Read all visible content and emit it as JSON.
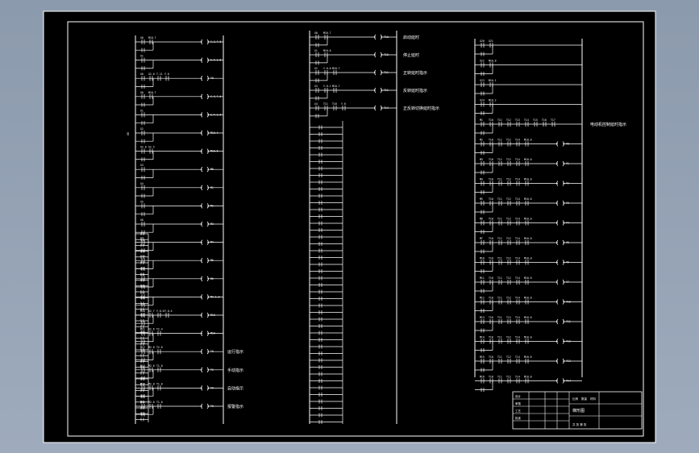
{
  "colors": {
    "background": "#9eabbd",
    "sheet": "#000000",
    "ink": "#ffffff"
  },
  "diagram_kind": "plc-ladder-diagram",
  "rail_labels": {
    "left_power_rail": "X0"
  },
  "left_column": {
    "rungs": [
      {
        "contacts": [
          "X0",
          "M10.7"
        ],
        "coil": "C.S.F.5",
        "comment": ""
      },
      {
        "contacts": [
          "X1"
        ],
        "coil": "S.F.1.5",
        "comment": ""
      },
      {
        "contacts": [
          "X0",
          "X2.0",
          "T.11",
          "Y.0"
        ],
        "coil": "Y0",
        "comment": ""
      },
      {
        "contacts": [
          "X0",
          "M10.7"
        ],
        "coil": "C.S.F.6",
        "comment": ""
      },
      {
        "contacts": [
          "X1"
        ],
        "coil": "S.F.1.6",
        "comment": ""
      },
      {
        "contacts": [
          "X2"
        ],
        "coil": "M10.4",
        "comment": ""
      },
      {
        "contacts": [
          "X2.0",
          "X2.5"
        ],
        "coil": "M10.5",
        "comment": ""
      },
      {
        "contacts": [
          "X3"
        ],
        "coil": "M0",
        "comment": ""
      },
      {
        "contacts": [
          "X4"
        ],
        "coil": "M1",
        "comment": ""
      },
      {
        "contacts": [
          "X5"
        ],
        "coil": "M2",
        "comment": ""
      },
      {
        "contacts": [
          "X6"
        ],
        "coil": "M3",
        "comment": ""
      },
      {
        "contacts": [
          "X7"
        ],
        "coil": "M4",
        "comment": ""
      },
      {
        "contacts": [
          "X10"
        ],
        "coil": "M5",
        "comment": ""
      },
      {
        "contacts": [
          "X11"
        ],
        "coil": "M6",
        "comment": ""
      },
      {
        "contacts": [
          "X12"
        ],
        "coil": "M2.1.0",
        "comment": ""
      },
      {
        "contacts": [
          "M10",
          "X2.7",
          "Y.0.0",
          "Y.0.4"
        ],
        "coil": "M10",
        "comment": ""
      },
      {
        "contacts": [
          "M11",
          "X2.6",
          "T2.4"
        ],
        "coil": "M10",
        "comment": ""
      },
      {
        "contacts": [
          "M12",
          "M2.0",
          "T2.0"
        ],
        "coil": "T0",
        "comment": "运行指示"
      },
      {
        "contacts": [
          "M13",
          "M2.0",
          "T1.0"
        ],
        "coil": "T0",
        "comment": "手动指示"
      },
      {
        "contacts": [
          "M14",
          "M2.0",
          "T1.0"
        ],
        "coil": "T0",
        "comment": "自动指示"
      },
      {
        "contacts": [
          "M15",
          "M2.0",
          "T1.0"
        ],
        "coil": "T0",
        "comment": "报警指示"
      }
    ]
  },
  "middle_column": {
    "rungs": [
      {
        "contacts": [
          "X0",
          "M10.7"
        ],
        "coil": "T10",
        "comment": "启动延时"
      },
      {
        "contacts": [
          "X1",
          "M10.6"
        ],
        "coil": "T10",
        "comment": "停止延时"
      },
      {
        "contacts": [
          "X2",
          "Y.0.0",
          "M10.7"
        ],
        "coil": "T11",
        "comment": "正转延时指示"
      },
      {
        "contacts": [
          "X3",
          "Y.0.1",
          "M10.7"
        ],
        "coil": "T11",
        "comment": "反转延时指示"
      },
      {
        "contacts": [
          "X4",
          "T11",
          "T10",
          "Y.0"
        ],
        "coil": "T14",
        "comment": "正反转切换延时指示"
      }
    ]
  },
  "right_column": {
    "rungs": [
      {
        "contacts": [
          "X20",
          "X21"
        ],
        "coil": "",
        "comment": ""
      },
      {
        "contacts": [
          "X22",
          "M10.0"
        ],
        "coil": "",
        "comment": ""
      },
      {
        "contacts": [
          "X23",
          "M10.1"
        ],
        "coil": "",
        "comment": ""
      },
      {
        "contacts": [
          "X24",
          "M10.2"
        ],
        "coil": "",
        "comment": ""
      },
      {
        "contacts": [
          "M1",
          "T10",
          "T11",
          "T12",
          "T13",
          "T14",
          "T15",
          "T16",
          "T17"
        ],
        "coil": "",
        "comment": "电动机控制延时指示"
      },
      {
        "contacts": [
          "M2",
          "T10",
          "T11",
          "T12",
          "T14",
          "M10.0"
        ],
        "coil": "Y0",
        "comment": ""
      },
      {
        "contacts": [
          "M3",
          "T10",
          "T11",
          "T12",
          "T14",
          "M10.0"
        ],
        "coil": "Y1",
        "comment": ""
      },
      {
        "contacts": [
          "M4",
          "T10",
          "T11",
          "T12",
          "T14",
          "M10.0"
        ],
        "coil": "Y2",
        "comment": ""
      },
      {
        "contacts": [
          "M5",
          "T10",
          "T11",
          "T12",
          "T14",
          "M10.0"
        ],
        "coil": "Y3",
        "comment": ""
      },
      {
        "contacts": [
          "M6",
          "T10",
          "T11",
          "T12",
          "T14",
          "M10.0"
        ],
        "coil": "Y4",
        "comment": ""
      },
      {
        "contacts": [
          "M7",
          "T10",
          "T11",
          "T12",
          "T14",
          "M10.0"
        ],
        "coil": "Y5",
        "comment": ""
      },
      {
        "contacts": [
          "M10",
          "T10",
          "T11",
          "T12",
          "T14",
          "M10.0"
        ],
        "coil": "Y6",
        "comment": ""
      },
      {
        "contacts": [
          "M11",
          "T10",
          "T11",
          "T12",
          "T14",
          "M10.0"
        ],
        "coil": "Y7",
        "comment": ""
      },
      {
        "contacts": [
          "M12",
          "T10",
          "T11",
          "T12",
          "T14",
          "M10.0"
        ],
        "coil": "Y10",
        "comment": ""
      },
      {
        "contacts": [
          "M13",
          "T10",
          "T11",
          "T12",
          "T14",
          "M10.0"
        ],
        "coil": "Y11",
        "comment": ""
      },
      {
        "contacts": [
          "M14",
          "T10",
          "T11",
          "T12",
          "T14",
          "M10.0"
        ],
        "coil": "Y12",
        "comment": ""
      },
      {
        "contacts": [
          "M15",
          "T10",
          "T11",
          "T12",
          "T14",
          "M10.0"
        ],
        "coil": "Y13",
        "comment": ""
      },
      {
        "contacts": [
          "M16",
          "T10",
          "T11",
          "T12",
          "T14",
          "M10.0"
        ],
        "coil": "Y14",
        "comment": ""
      }
    ]
  },
  "title_block": {
    "title": "梯形图",
    "row_labels": [
      "设计",
      "审核",
      "工艺",
      "批准"
    ],
    "scale_labels": [
      "比例",
      "数量",
      "材料"
    ],
    "sheet_label": "共 张 第 张"
  }
}
